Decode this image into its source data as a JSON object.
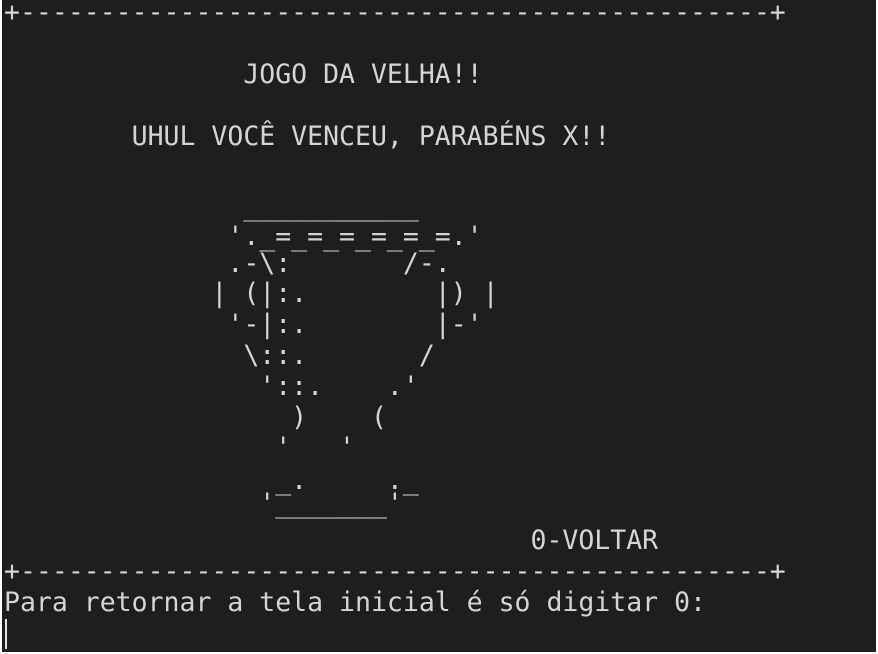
{
  "terminal": {
    "border_top": "+-----------------------------------------------+",
    "title": "               JOGO DA VELHA!!",
    "message": "        UHUL VOCÊ VENCEU, PARABÉNS X!!",
    "trophy": [
      "               ___________",
      "              '._=_=_=_=_=_=.'",
      "              .-\\:       /-.",
      "             | (|:.        |) |",
      "              '-|:.        |-'",
      "               \\::.       /",
      "                '::.    .'",
      "                  )    (",
      "                 '   '",
      "                 _.     ._",
      "                '_______'"
    ],
    "back_option": "                                 0-VOLTAR",
    "border_bottom": "+-----------------------------------------------+",
    "prompt": "Para retornar a tela inicial é só digitar 0:"
  }
}
